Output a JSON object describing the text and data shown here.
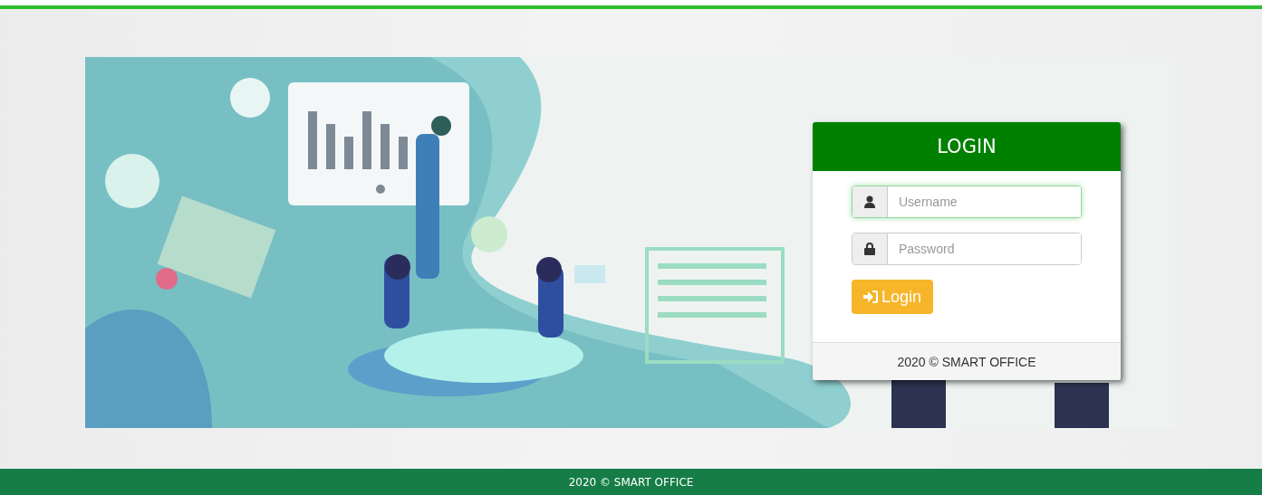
{
  "login_card": {
    "title": "LOGIN",
    "fields": [
      {
        "kind": "user",
        "placeholder": "Username",
        "focused": true
      },
      {
        "kind": "lock",
        "placeholder": "Password",
        "focused": false
      }
    ],
    "button": "Login",
    "footer": "2020 © SMART OFFICE"
  },
  "footer": "2020 © SMART OFFICE"
}
